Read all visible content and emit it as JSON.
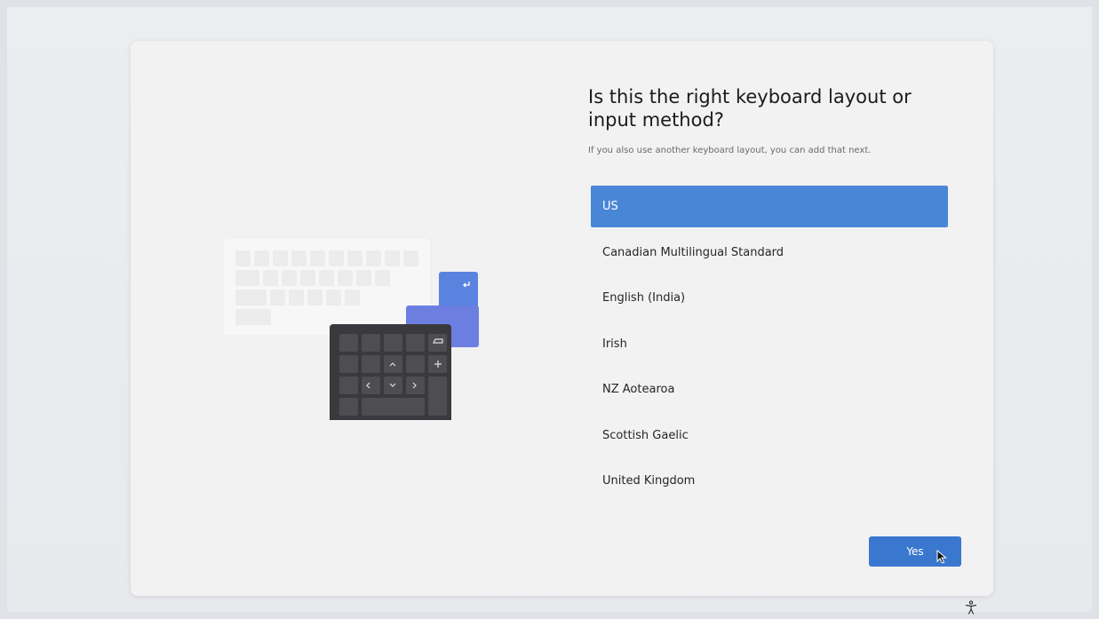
{
  "page": {
    "heading": "Is this the right keyboard layout or input method?",
    "subtext": "If you also use another keyboard layout, you can add that next."
  },
  "layouts": [
    {
      "label": "US",
      "selected": true
    },
    {
      "label": "Canadian Multilingual Standard",
      "selected": false
    },
    {
      "label": "English (India)",
      "selected": false
    },
    {
      "label": "Irish",
      "selected": false
    },
    {
      "label": "NZ Aotearoa",
      "selected": false
    },
    {
      "label": "Scottish Gaelic",
      "selected": false
    },
    {
      "label": "United Kingdom",
      "selected": false
    }
  ],
  "actions": {
    "yes_label": "Yes"
  },
  "icons": {
    "illustration": "keyboard-illustration-icon",
    "pointer": "mouse-pointer-icon",
    "accessibility": "accessibility-icon"
  },
  "colors": {
    "accent": "#3a78cf",
    "selected_row": "#4a86d6",
    "keypad": "#3a3a3e"
  }
}
